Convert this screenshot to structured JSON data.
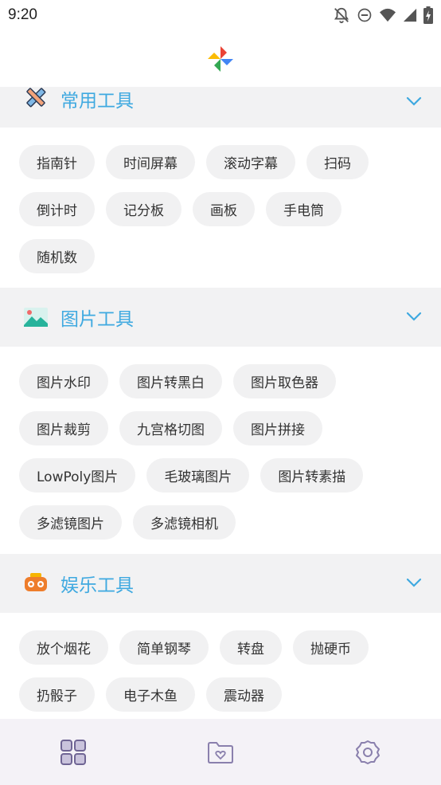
{
  "status": {
    "time": "9:20"
  },
  "sections": [
    {
      "title": "常用工具",
      "icon": "ruler-pencil-icon",
      "tools": [
        "指南针",
        "时间屏幕",
        "滚动字幕",
        "扫码",
        "倒计时",
        "记分板",
        "画板",
        "手电筒",
        "随机数"
      ]
    },
    {
      "title": "图片工具",
      "icon": "landscape-image-icon",
      "tools": [
        "图片水印",
        "图片转黑白",
        "图片取色器",
        "图片裁剪",
        "九宫格切图",
        "图片拼接",
        "LowPoly图片",
        "毛玻璃图片",
        "图片转素描",
        "多滤镜图片",
        "多滤镜相机"
      ]
    },
    {
      "title": "娱乐工具",
      "icon": "game-controller-icon",
      "tools": [
        "放个烟花",
        "简单钢琴",
        "转盘",
        "抛硬币",
        "扔骰子",
        "电子木鱼",
        "震动器"
      ]
    }
  ],
  "bottom_nav": [
    "grid-apps-icon",
    "folder-heart-icon",
    "settings-gear-icon"
  ],
  "colors": {
    "accent": "#3fa9e0",
    "chip_bg": "#f1f1f2",
    "section_bg": "#f2f2f3",
    "nav_icon": "#7a6f9e"
  }
}
